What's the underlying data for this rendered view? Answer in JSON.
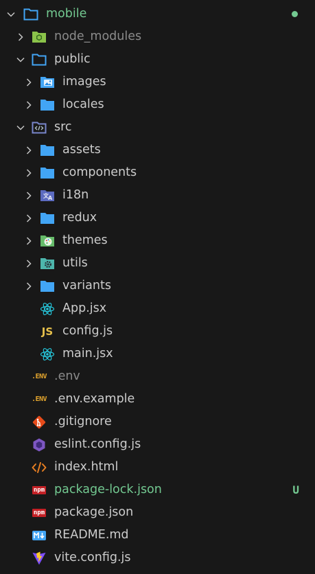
{
  "explorer": {
    "root": {
      "label": "mobile",
      "status": "modified"
    },
    "items": [
      {
        "label": "node_modules",
        "icon": "nodejs-folder-icon"
      },
      {
        "label": "public",
        "icon": "folder-open-icon"
      },
      {
        "label": "images",
        "icon": "images-folder-icon"
      },
      {
        "label": "locales",
        "icon": "folder-icon"
      },
      {
        "label": "src",
        "icon": "src-folder-icon"
      },
      {
        "label": "assets",
        "icon": "folder-icon"
      },
      {
        "label": "components",
        "icon": "folder-icon"
      },
      {
        "label": "i18n",
        "icon": "i18n-folder-icon"
      },
      {
        "label": "redux",
        "icon": "folder-icon"
      },
      {
        "label": "themes",
        "icon": "palette-folder-icon"
      },
      {
        "label": "utils",
        "icon": "utils-folder-icon"
      },
      {
        "label": "variants",
        "icon": "folder-icon"
      },
      {
        "label": "App.jsx",
        "icon": "react-icon"
      },
      {
        "label": "config.js",
        "icon": "javascript-icon",
        "icon_text": "JS"
      },
      {
        "label": "main.jsx",
        "icon": "react-icon"
      },
      {
        "label": ".env",
        "icon": "env-icon",
        "icon_text": ".ENV"
      },
      {
        "label": ".env.example",
        "icon": "env-icon",
        "icon_text": ".ENV"
      },
      {
        "label": ".gitignore",
        "icon": "git-icon"
      },
      {
        "label": "eslint.config.js",
        "icon": "eslint-icon"
      },
      {
        "label": "index.html",
        "icon": "html-icon"
      },
      {
        "label": "package-lock.json",
        "icon": "npm-icon",
        "icon_text": "npm",
        "status": "U"
      },
      {
        "label": "package.json",
        "icon": "npm-icon",
        "icon_text": "npm"
      },
      {
        "label": "README.md",
        "icon": "markdown-icon"
      },
      {
        "label": "vite.config.js",
        "icon": "vite-icon"
      }
    ]
  },
  "colors": {
    "background": "#181818",
    "text": "#cccccc",
    "dimmed_text": "#8b8b8b",
    "git_untracked": "#73c991",
    "folder_blue": "#42a5f5"
  }
}
